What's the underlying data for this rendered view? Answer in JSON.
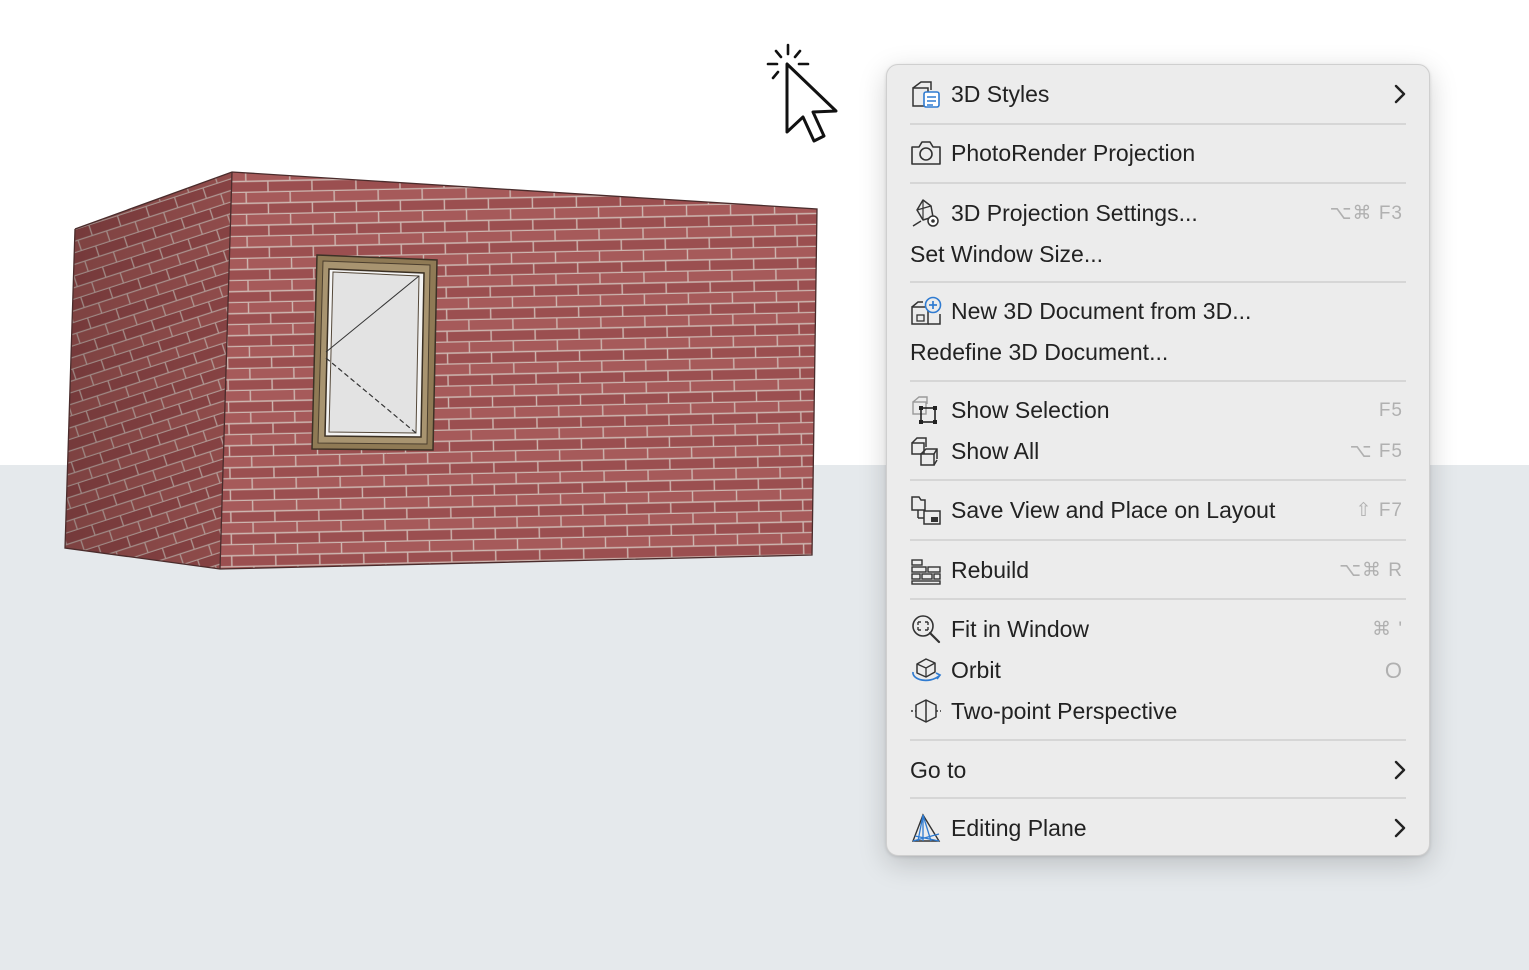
{
  "menu": {
    "items": [
      {
        "label": "3D Styles",
        "icon": "3d-styles-icon",
        "submenu": true
      },
      {
        "label": "PhotoRender Projection",
        "icon": "camera-icon"
      },
      {
        "label": "3D Projection Settings...",
        "icon": "projection-settings-icon",
        "shortcut": "⌥⌘ F3"
      },
      {
        "label": "Set Window Size..."
      },
      {
        "label": "New 3D Document from 3D...",
        "icon": "new-3d-document-icon"
      },
      {
        "label": "Redefine 3D Document..."
      },
      {
        "label": "Show Selection",
        "icon": "show-selection-icon",
        "shortcut": "F5"
      },
      {
        "label": "Show All",
        "icon": "show-all-icon",
        "shortcut": "⌥ F5"
      },
      {
        "label": "Save View and Place on Layout",
        "icon": "save-view-layout-icon",
        "shortcut": "⇧ F7"
      },
      {
        "label": "Rebuild",
        "icon": "rebuild-bricks-icon",
        "shortcut": "⌥⌘ R"
      },
      {
        "label": "Fit in Window",
        "icon": "fit-in-window-icon",
        "shortcut": "⌘ '"
      },
      {
        "label": "Orbit",
        "icon": "orbit-icon",
        "shortcut": "O"
      },
      {
        "label": "Two-point Perspective",
        "icon": "two-point-perspective-icon"
      },
      {
        "label": "Go to",
        "submenu": true
      },
      {
        "label": "Editing Plane",
        "icon": "editing-plane-icon",
        "submenu": true
      }
    ]
  },
  "colors": {
    "menu_bg": "#ececec",
    "ground": "#e5e9ec",
    "brick": "#9a4c4c",
    "icon_blue": "#2f7bd1"
  }
}
